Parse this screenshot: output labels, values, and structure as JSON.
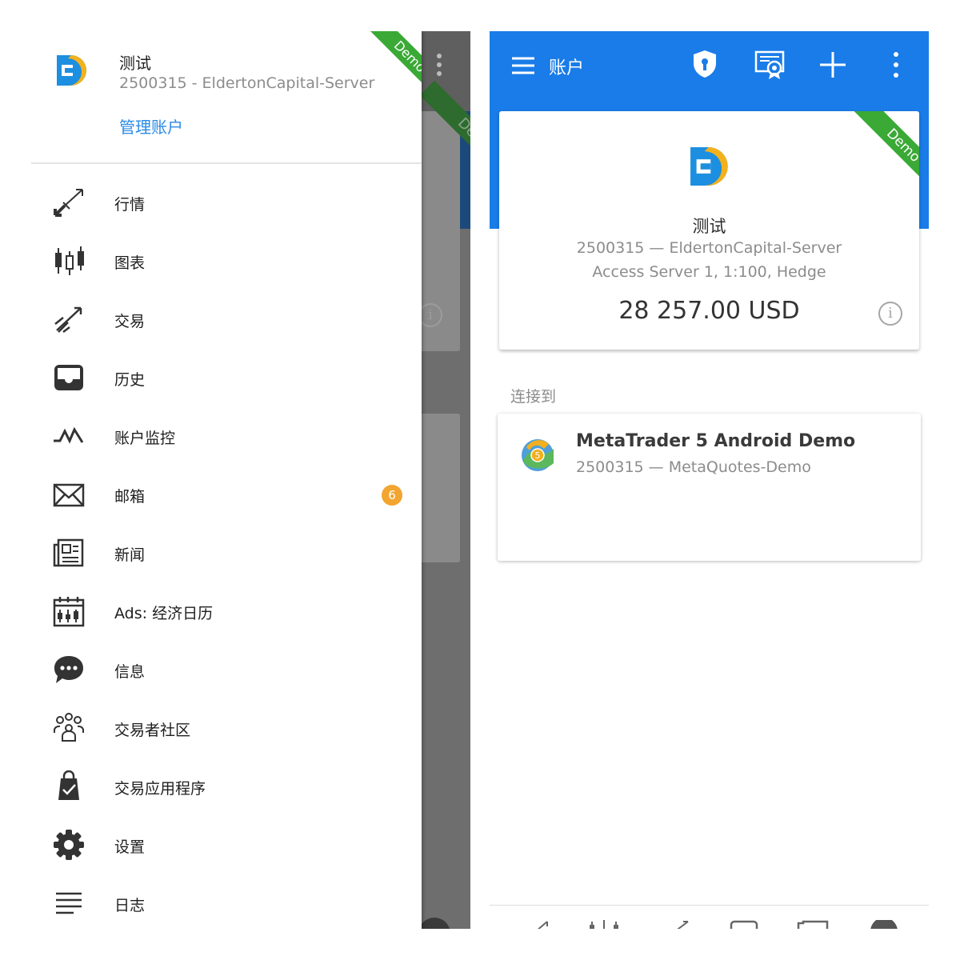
{
  "left": {
    "background": {
      "ribbon": "Demo"
    },
    "drawer": {
      "account_name": "测试",
      "account_line": "2500315 - EldertonCapital-Server",
      "manage_label": "管理账户",
      "ribbon": "Demo",
      "menu": [
        {
          "label": "行情",
          "icon": "quotes-arrows-icon"
        },
        {
          "label": "图表",
          "icon": "candlestick-icon"
        },
        {
          "label": "交易",
          "icon": "trade-icon"
        },
        {
          "label": "历史",
          "icon": "inbox-history-icon"
        },
        {
          "label": "账户监控",
          "icon": "monitoring-icon"
        },
        {
          "label": "邮箱",
          "icon": "mail-icon",
          "badge": "6"
        },
        {
          "label": "新闻",
          "icon": "news-icon"
        },
        {
          "label": "Ads: 经济日历",
          "icon": "calendar-icon"
        },
        {
          "label": "信息",
          "icon": "chat-icon"
        },
        {
          "label": "交易者社区",
          "icon": "community-icon"
        },
        {
          "label": "交易应用程序",
          "icon": "shopping-bag-icon"
        },
        {
          "label": "设置",
          "icon": "gear-icon"
        },
        {
          "label": "日志",
          "icon": "journal-icon"
        }
      ]
    }
  },
  "right": {
    "appbar": {
      "title": "账户"
    },
    "account_card": {
      "ribbon": "Demo",
      "name": "测试",
      "line1": "2500315 — EldertonCapital-Server",
      "line2": "Access Server 1, 1:100, Hedge",
      "balance": "28 257.00 USD"
    },
    "connected_label": "连接到",
    "server_card": {
      "title": "MetaTrader 5 Android Demo",
      "subtitle": "2500315 — MetaQuotes-Demo"
    }
  },
  "colors": {
    "accent_blue": "#1a7ce8",
    "link_blue": "#2a8ae6",
    "demo_green": "#3aa935",
    "badge_orange": "#f2a530"
  }
}
